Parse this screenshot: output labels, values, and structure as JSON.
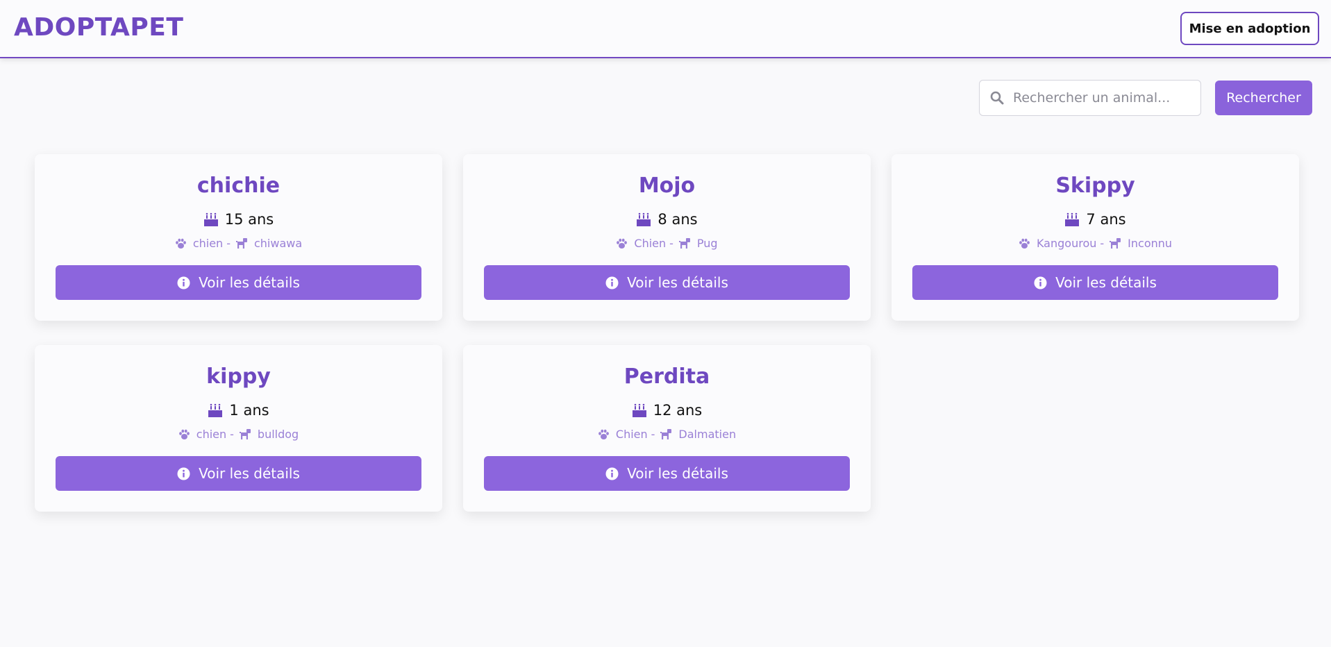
{
  "header": {
    "brand": "ADOPTAPET",
    "adopt_button": "Mise en adoption"
  },
  "search": {
    "placeholder": "Rechercher un animal...",
    "value": "",
    "button_label": "Rechercher",
    "icon": "search-icon"
  },
  "colors": {
    "accent": "#6e48c0",
    "button": "#8c65dd",
    "meta_text": "#9a80d6"
  },
  "cards": [
    {
      "name": "chichie",
      "age": "15 ans",
      "species": "chien",
      "separator": "-",
      "breed": "chiwawa",
      "button": "Voir les détails"
    },
    {
      "name": "Mojo",
      "age": "8 ans",
      "species": "Chien",
      "separator": "-",
      "breed": "Pug",
      "button": "Voir les détails"
    },
    {
      "name": "Skippy",
      "age": "7 ans",
      "species": "Kangourou",
      "separator": "-",
      "breed": "Inconnu",
      "button": "Voir les détails"
    },
    {
      "name": "kippy",
      "age": "1 ans",
      "species": "chien",
      "separator": "-",
      "breed": "bulldog",
      "button": "Voir les détails"
    },
    {
      "name": "Perdita",
      "age": "12 ans",
      "species": "Chien",
      "separator": "-",
      "breed": "Dalmatien",
      "button": "Voir les détails"
    }
  ]
}
